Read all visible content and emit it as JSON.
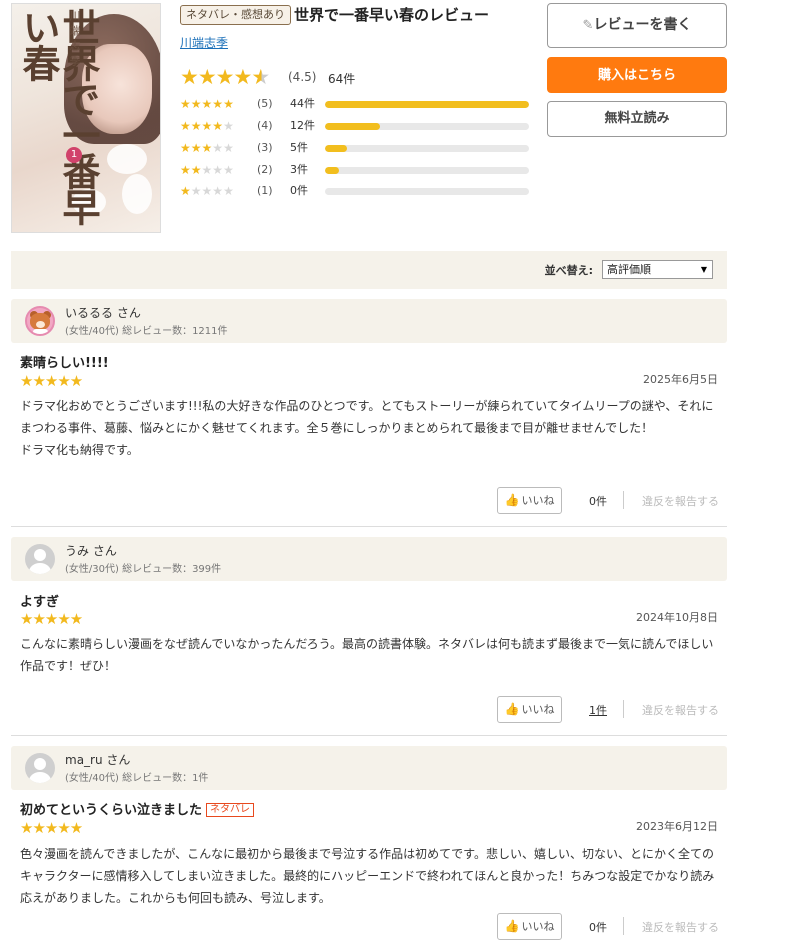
{
  "book": {
    "cover_title": "世界で一番早い春",
    "cover_author": "川端志季",
    "cover_volume": "1",
    "badge": "ネタバレ・感想あり",
    "title": "世界で一番早い春のレビュー",
    "author": "川端志季"
  },
  "rating": {
    "average": 4.5,
    "average_label": "(4.5)",
    "count_label": "64件",
    "distribution": [
      {
        "level": "(5)",
        "count": "44件",
        "fraction": 1.0,
        "stars": 5
      },
      {
        "level": "(4)",
        "count": "12件",
        "fraction": 0.27,
        "stars": 4
      },
      {
        "level": "(3)",
        "count": "5件",
        "fraction": 0.11,
        "stars": 3
      },
      {
        "level": "(2)",
        "count": "3件",
        "fraction": 0.07,
        "stars": 2
      },
      {
        "level": "(1)",
        "count": "0件",
        "fraction": 0.0,
        "stars": 1
      }
    ]
  },
  "actions": {
    "write_review": "レビューを書く",
    "buy": "購入はこちら",
    "free_trial": "無料立読み"
  },
  "sort": {
    "label": "並べ替え:",
    "selected": "高評価順"
  },
  "reviews": [
    {
      "name": "いるるる さん",
      "meta": "(女性/40代)  総レビュー数：1211件",
      "title": "素晴らしい!!!!",
      "spoiler": "",
      "stars": 5,
      "date": "2025年6月5日",
      "body": "ドラマ化おめでとうございます!!!私の大好きな作品のひとつです。とてもストーリーが練られていてタイムリープの謎や、それにまつわる事件、葛藤、悩みとにかく魅せてくれます。全５巻にしっかりまとめられて最後まで目が離せませんでした！\nドラマ化も納得です。",
      "like_label": "いいね",
      "like_count": "0件",
      "report": "違反を報告する"
    },
    {
      "name": "うみ さん",
      "meta": "(女性/30代)  総レビュー数：399件",
      "title": "よすぎ",
      "spoiler": "",
      "stars": 5,
      "date": "2024年10月8日",
      "body": "こんなに素晴らしい漫画をなぜ読んでいなかったんだろう。最高の読書体験。ネタバレは何も読まず最後まで一気に読んでほしい作品です！ぜひ！",
      "like_label": "いいね",
      "like_count": "1件",
      "report": "違反を報告する"
    },
    {
      "name": "ma_ru さん",
      "meta": "(女性/40代)  総レビュー数：1件",
      "title": "初めてというくらい泣きました",
      "spoiler": "ネタバレ",
      "stars": 5,
      "date": "2023年6月12日",
      "body": "色々漫画を読んできましたが、こんなに最初から最後まで号泣する作品は初めてです。悲しい、嬉しい、切ない、とにかく全てのキャラクターに感情移入してしまい泣きました。最終的にハッピーエンドで終われてほんと良かった！ちみつな設定でかなり読み応えがありました。これからも何回も読み、号泣します。",
      "like_label": "いいね",
      "like_count": "0件",
      "report": "違反を報告する"
    }
  ],
  "colors": {
    "accent_orange": "#ff7a0f",
    "star": "#f2b91e",
    "spoiler": "#e8491e",
    "link": "#1a6fb8",
    "panel": "#f5f2ea"
  }
}
